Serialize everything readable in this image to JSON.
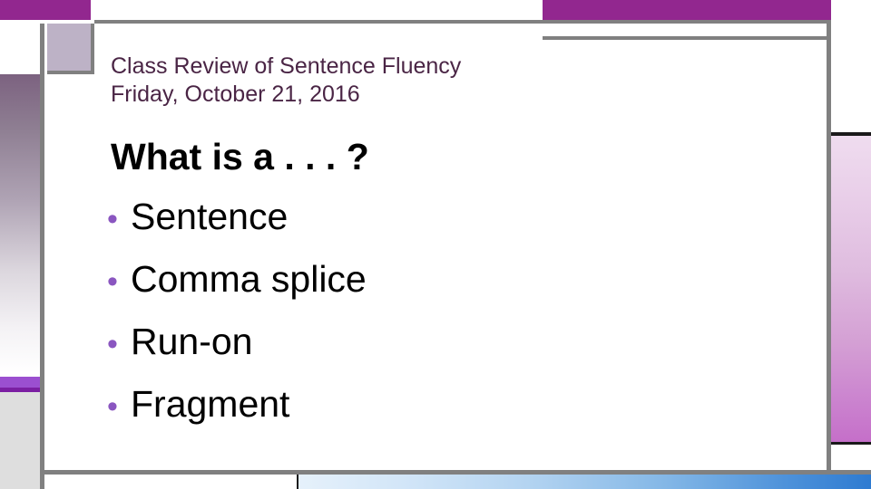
{
  "slide": {
    "heading": {
      "line1": "Class Review of Sentence Fluency",
      "line2": "Friday, October 21, 2016"
    },
    "body": {
      "title": "What is a . . . ?",
      "bullet_glyph": "•",
      "bullets": [
        {
          "text": "Sentence"
        },
        {
          "text": "Comma splice"
        },
        {
          "text": "Run-on"
        },
        {
          "text": "Fragment"
        }
      ]
    },
    "colors": {
      "purple_bar": "#92278F",
      "heading_text": "#4A2545",
      "body_text": "#000000",
      "bullet_marker": "#8A56C0",
      "frame_gray": "#808080",
      "lavender_square": "#BDB2C6",
      "left_gradient_top": "#7C6280",
      "left_gradient_bottom": "#FFFFFF",
      "left_accent_strip": "#9B4FD0",
      "right_gradient_top": "#EFDCEF",
      "right_gradient_bottom": "#C56FC9",
      "bottom_gradient_left": "#E6F1FB",
      "bottom_gradient_right": "#2E7BD1",
      "bottom_gray_block": "#DEDEDE"
    }
  }
}
